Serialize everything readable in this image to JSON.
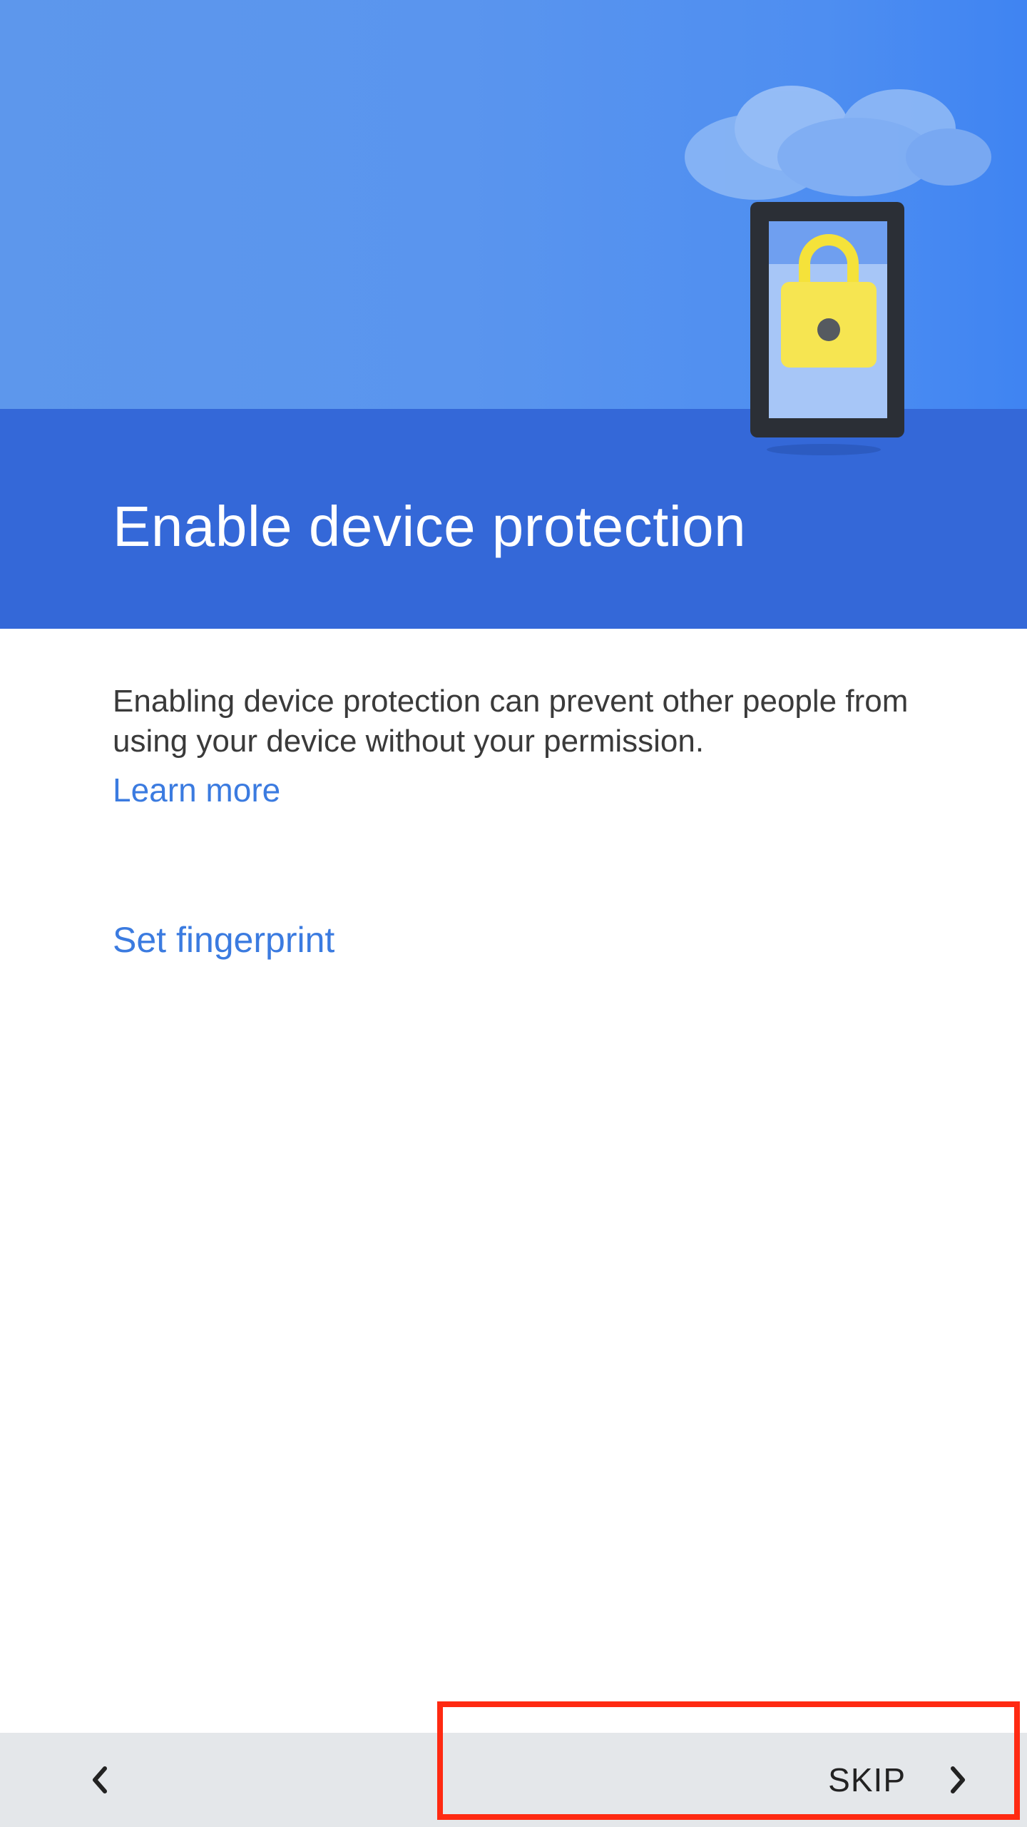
{
  "header": {
    "title": "Enable device protection"
  },
  "body": {
    "description": "Enabling device protection can prevent other people from using your device without your permission.",
    "learn_more": "Learn more",
    "set_fingerprint": "Set fingerprint"
  },
  "nav": {
    "skip_label": "SKIP",
    "back_icon": "chevron-left-icon",
    "next_icon": "chevron-right-icon"
  },
  "colors": {
    "header_top": "#5a95ee",
    "header_bottom": "#3468d8",
    "link": "#3b7be0",
    "nav_bar": "#e4e7ea",
    "highlight": "#ff2a12",
    "lock": "#f5e23a"
  }
}
